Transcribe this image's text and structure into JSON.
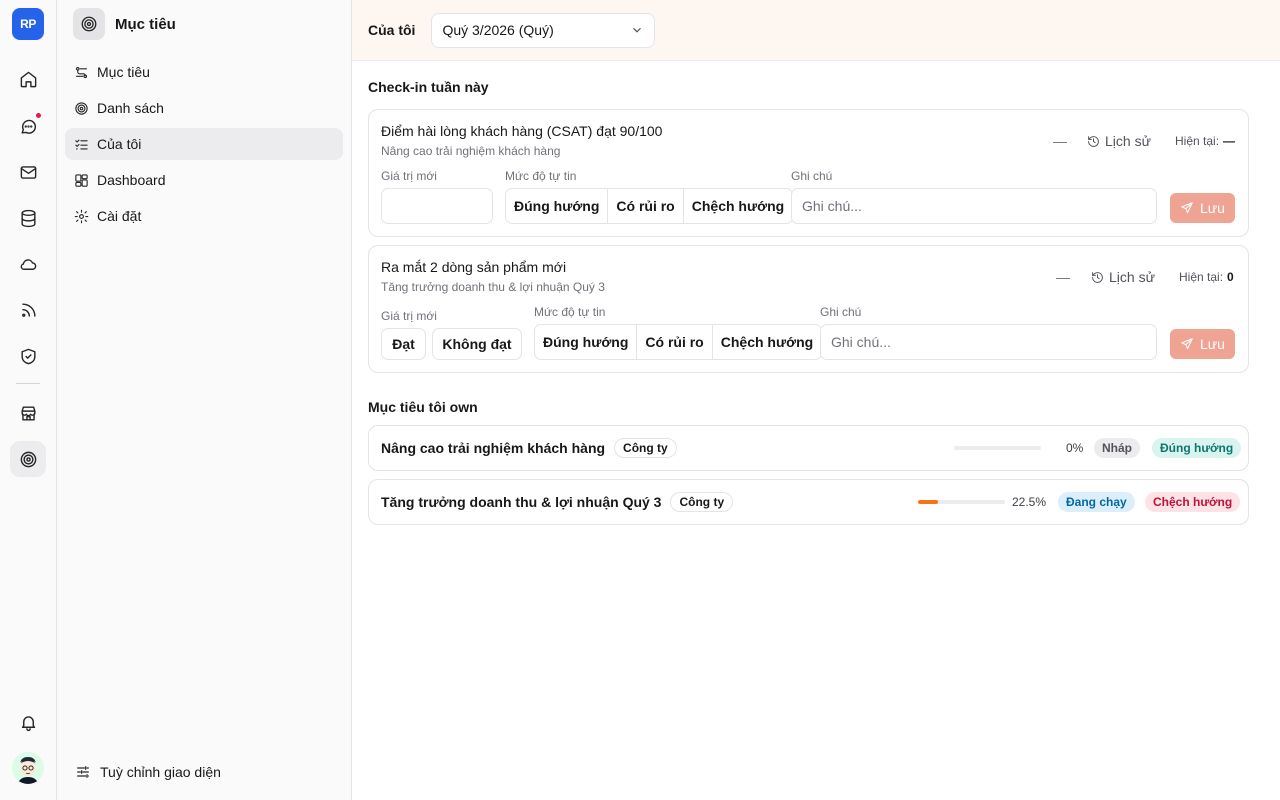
{
  "rail": {
    "logo": "RP",
    "items": [
      "home",
      "chat",
      "mail",
      "database",
      "cloud",
      "rss",
      "shield",
      "store",
      "target"
    ]
  },
  "sidebar": {
    "title": "Mục tiêu",
    "items": [
      {
        "label": "Mục tiêu",
        "icon": "goals-icon"
      },
      {
        "label": "Danh sách",
        "icon": "target-icon"
      },
      {
        "label": "Của tôi",
        "icon": "list-check-icon"
      },
      {
        "label": "Dashboard",
        "icon": "dashboard-icon"
      },
      {
        "label": "Cài đặt",
        "icon": "gear-icon"
      }
    ],
    "footer": "Tuỳ chỉnh giao diện"
  },
  "topbar": {
    "title": "Của tôi",
    "period": "Quý 3/2026 (Quý)"
  },
  "checkin": {
    "title": "Check-in tuần này",
    "cards": [
      {
        "title": "Điểm hài lòng khách hàng (CSAT) đạt 90/100",
        "subtitle": "Nâng cao trải nghiệm khách hàng",
        "dash": "—",
        "history": "Lịch sử",
        "current_label": "Hiện tại:",
        "current_value": "—",
        "value_label": "Giá trị mới",
        "confidence_label": "Mức độ tự tin",
        "confidence_options": [
          "Đúng hướng",
          "Có rủi ro",
          "Chệch hướng"
        ],
        "note_label": "Ghi chú",
        "note_placeholder": "Ghi chú...",
        "save": "Lưu"
      },
      {
        "title": "Ra mắt 2 dòng sản phẩm mới",
        "subtitle": "Tăng trưởng doanh thu & lợi nhuận Quý 3",
        "dash": "—",
        "history": "Lịch sử",
        "current_label": "Hiện tại:",
        "current_value": "0",
        "value_label": "Giá trị mới",
        "value_options": [
          "Đạt",
          "Không đạt"
        ],
        "confidence_label": "Mức độ tự tin",
        "confidence_options": [
          "Đúng hướng",
          "Có rủi ro",
          "Chệch hướng"
        ],
        "note_label": "Ghi chú",
        "note_placeholder": "Ghi chú...",
        "save": "Lưu"
      }
    ]
  },
  "owned": {
    "title": "Mục tiêu tôi own",
    "rows": [
      {
        "name": "Nâng cao trải nghiệm khách hàng",
        "tag": "Công ty",
        "progress": 0,
        "progress_label": "0%",
        "status": "Nháp",
        "confidence": "Đúng hướng"
      },
      {
        "name": "Tăng trưởng doanh thu & lợi nhuận Quý 3",
        "tag": "Công ty",
        "progress": 22.5,
        "progress_label": "22.5%",
        "status": "Đang chạy",
        "confidence": "Chệch hướng"
      }
    ]
  },
  "colors": {
    "accent": "#2563eb",
    "save": "#eea393",
    "progress": "#f97316",
    "on_track_bg": "#d9f3ef",
    "on_track_fg": "#0f766e",
    "off_track_bg": "#fde2e6",
    "off_track_fg": "#be123c",
    "running_bg": "#dbeefa",
    "running_fg": "#0369a1",
    "draft_bg": "#ececee"
  }
}
